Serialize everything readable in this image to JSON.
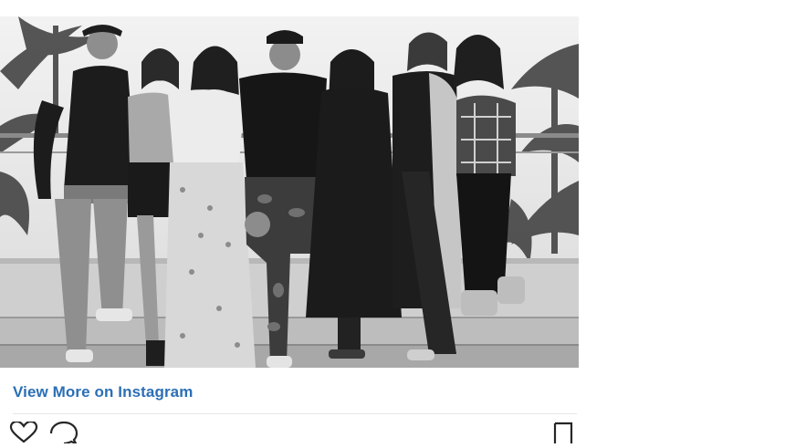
{
  "post": {
    "view_more_label": "View More on Instagram"
  },
  "icons": {
    "like": "heart-icon",
    "comment": "comment-icon",
    "save": "bookmark-icon"
  },
  "colors": {
    "link": "#2b6fb6",
    "icon_stroke": "#262626"
  }
}
